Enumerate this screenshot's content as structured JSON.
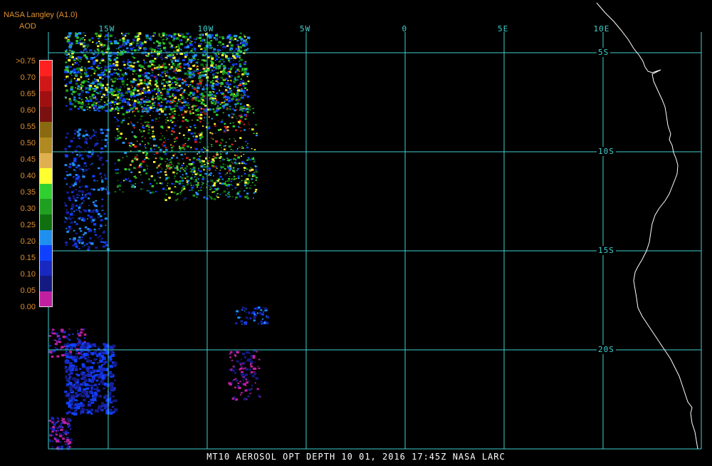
{
  "header": {
    "source_label": "NASA Langley (A1.0)",
    "product_label": "AOD"
  },
  "legend": {
    "labels": [
      ">0.75",
      "0.70",
      "0.65",
      "0.60",
      "0.55",
      "0.50",
      "0.45",
      "0.40",
      "0.35",
      "0.30",
      "0.25",
      "0.20",
      "0.15",
      "0.10",
      "0.05",
      "0.00"
    ],
    "colors": [
      "#ff2020",
      "#d01818",
      "#a01010",
      "#7a1010",
      "#8a6a10",
      "#b08a20",
      "#e0b050",
      "#ffff30",
      "#30d030",
      "#20a020",
      "#107010",
      "#2090f0",
      "#1040ff",
      "#1828c0",
      "#141a80",
      "#c020a0"
    ],
    "label_color": "#e09030"
  },
  "grid": {
    "color": "#40d0d0",
    "longitudes": [
      "15W",
      "10W",
      "5W",
      "0",
      "5E",
      "10E"
    ],
    "latitudes": [
      "5S",
      "10S",
      "15S",
      "20S"
    ]
  },
  "coastline": {
    "color": "#ffffff"
  },
  "caption": "MT10  AEROSOL OPT DEPTH   10 01, 2016 17:45Z   NASA LARC",
  "colors": {
    "background": "#000000",
    "text": "#ffffff"
  }
}
